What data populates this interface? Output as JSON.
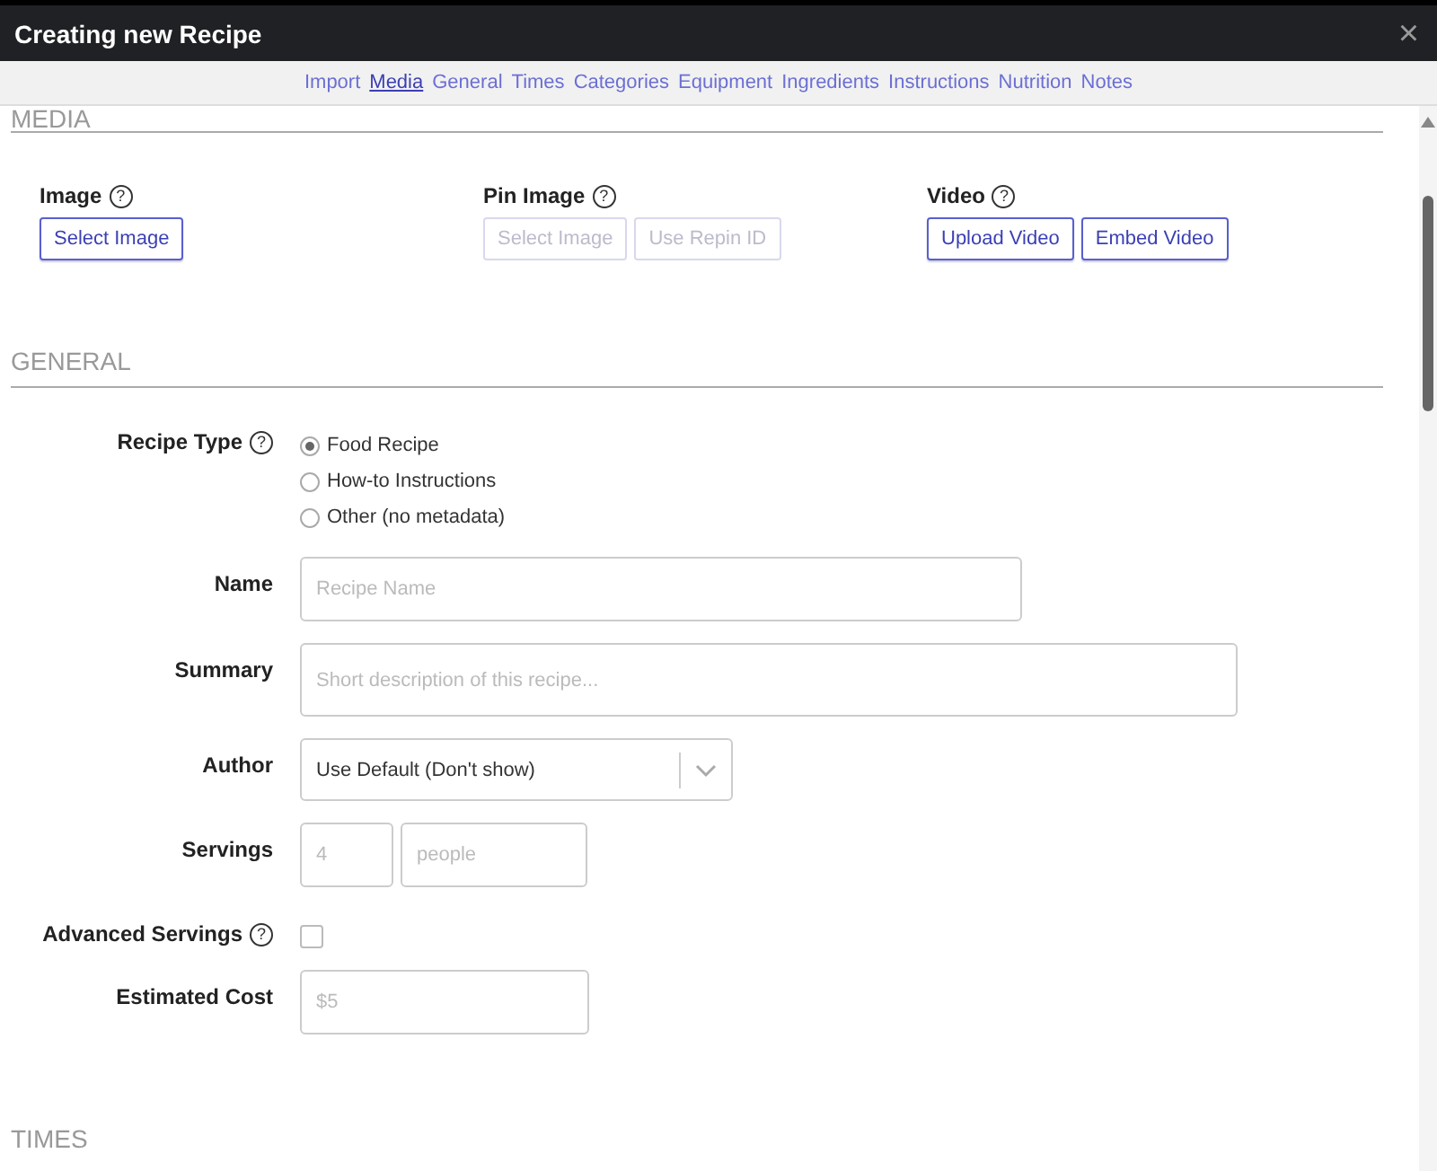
{
  "window": {
    "title": "Creating new Recipe",
    "close": "×"
  },
  "nav": [
    {
      "label": "Import",
      "selected": false
    },
    {
      "label": "Media",
      "selected": true
    },
    {
      "label": "General",
      "selected": false
    },
    {
      "label": "Times",
      "selected": false
    },
    {
      "label": "Categories",
      "selected": false
    },
    {
      "label": "Equipment",
      "selected": false
    },
    {
      "label": "Ingredients",
      "selected": false
    },
    {
      "label": "Instructions",
      "selected": false
    },
    {
      "label": "Nutrition",
      "selected": false
    },
    {
      "label": "Notes",
      "selected": false
    }
  ],
  "media": {
    "heading": "MEDIA",
    "groups": [
      {
        "label": "Image",
        "help": "?",
        "buttons": [
          {
            "label": "Select Image",
            "disabled": false
          }
        ]
      },
      {
        "label": "Pin Image",
        "help": "?",
        "buttons": [
          {
            "label": "Select Image",
            "disabled": true
          },
          {
            "label": "Use Repin ID",
            "disabled": true
          }
        ]
      },
      {
        "label": "Video",
        "help": "?",
        "buttons": [
          {
            "label": "Upload Video",
            "disabled": false
          },
          {
            "label": "Embed Video",
            "disabled": false
          }
        ]
      }
    ]
  },
  "general": {
    "heading": "GENERAL",
    "fields": [
      {
        "kind": "radio",
        "label": "Recipe Type",
        "help": "?",
        "options": [
          {
            "label": "Food Recipe",
            "selected": true
          },
          {
            "label": "How-to Instructions",
            "selected": false
          },
          {
            "label": "Other (no metadata)",
            "selected": false
          }
        ]
      },
      {
        "kind": "text",
        "label": "Name",
        "placeholder": "Recipe Name"
      },
      {
        "kind": "text",
        "label": "Summary",
        "placeholder": "Short description of this recipe..."
      },
      {
        "kind": "select",
        "label": "Author",
        "value": "Use Default (Don't show)"
      },
      {
        "kind": "servings",
        "label": "Servings",
        "amount_placeholder": "4",
        "unit_placeholder": "people"
      },
      {
        "kind": "checkbox",
        "label": "Advanced Servings",
        "help": "?",
        "checked": false
      },
      {
        "kind": "text",
        "label": "Estimated Cost",
        "placeholder": "$5"
      }
    ]
  },
  "times": {
    "heading": "TIMES"
  }
}
